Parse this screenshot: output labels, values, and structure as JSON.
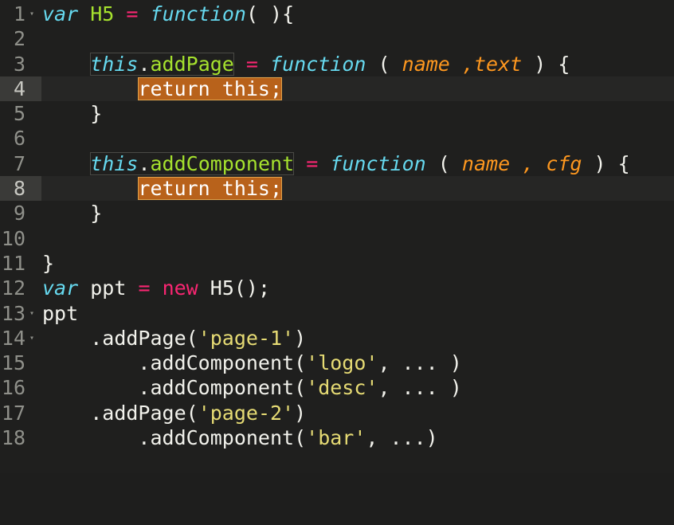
{
  "editor": {
    "lines": [
      {
        "n": "1",
        "tokens": [
          "var",
          "H5",
          "=",
          "function",
          "( ){"
        ]
      },
      {
        "n": "2"
      },
      {
        "n": "3",
        "tokens": [
          "this",
          ".",
          "addPage",
          "=",
          "function",
          "(",
          "name",
          ",text",
          ") {"
        ]
      },
      {
        "n": "4",
        "tokens": [
          "return this;"
        ]
      },
      {
        "n": "5",
        "tokens": [
          "}"
        ]
      },
      {
        "n": "6"
      },
      {
        "n": "7",
        "tokens": [
          "this",
          ".",
          "addComponent",
          "=",
          "function",
          "(",
          "name",
          ",",
          "cfg",
          ") {"
        ]
      },
      {
        "n": "8",
        "tokens": [
          "return this;"
        ]
      },
      {
        "n": "9",
        "tokens": [
          "}"
        ]
      },
      {
        "n": "10"
      },
      {
        "n": "11",
        "tokens": [
          "}"
        ]
      },
      {
        "n": "12",
        "tokens": [
          "var",
          "ppt",
          "=",
          "new",
          "H5();"
        ]
      },
      {
        "n": "13",
        "tokens": [
          "ppt"
        ]
      },
      {
        "n": "14",
        "tokens": [
          ".addPage(",
          "'page-1'",
          ")"
        ]
      },
      {
        "n": "15",
        "tokens": [
          ".addComponent(",
          "'logo'",
          ", ... )"
        ]
      },
      {
        "n": "16",
        "tokens": [
          ".addComponent(",
          "'desc'",
          ", ... )"
        ]
      },
      {
        "n": "17",
        "tokens": [
          ".addPage(",
          "'page-2'",
          ")"
        ]
      },
      {
        "n": "18",
        "tokens": [
          ".addComponent(",
          "'bar'",
          ", ...)"
        ]
      }
    ]
  },
  "colors": {
    "background": "#1f1f1e",
    "keyword": "#66d9ef",
    "class_name": "#a6e22e",
    "operator": "#f92672",
    "parameter": "#fd971f",
    "string": "#e6db74",
    "highlight": "#b8621b"
  }
}
